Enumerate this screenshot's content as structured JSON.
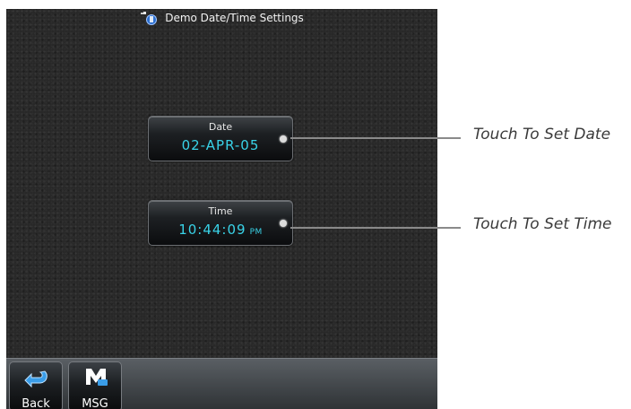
{
  "window": {
    "title": "Demo Date/Time Settings"
  },
  "date_button": {
    "label": "Date",
    "value": "02-APR-05"
  },
  "time_button": {
    "label": "Time",
    "value": "10:44:09",
    "ampm": "PM"
  },
  "softkeys": {
    "back_label": "Back",
    "msg_label": "MSG"
  },
  "callouts": {
    "date": "Touch To Set Date",
    "time": "Touch To Set Time"
  },
  "colors": {
    "screen_bg": "#272727",
    "value_text": "#39d3e8",
    "callout_text": "#3a3a3a",
    "callout_line": "#8a8a8a"
  },
  "icons": {
    "title": "garmin-settings-icon",
    "back": "back-arrow-icon",
    "msg": "message-icon"
  }
}
